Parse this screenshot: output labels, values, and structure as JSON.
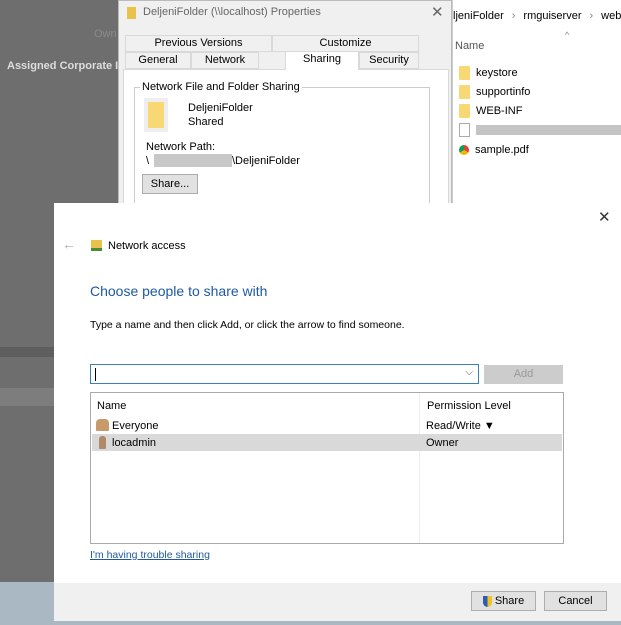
{
  "background": {
    "label_owner": "Own",
    "label_assigned": "Assigned Corporate I"
  },
  "properties": {
    "title": "DeljeniFolder (\\\\localhost) Properties",
    "tabs_row1": [
      "Previous Versions",
      "Customize"
    ],
    "tabs_row2": [
      "General",
      "Network",
      "Sharing",
      "Security"
    ],
    "group_title": "Network File and Folder Sharing",
    "folder_name": "DeljeniFolder",
    "folder_status": "Shared",
    "network_path_label": "Network Path:",
    "network_path_prefix": "\\",
    "network_path_suffix": "\\DeljeniFolder",
    "share_button": "Share..."
  },
  "explorer": {
    "breadcrumb": [
      "ljeniFolder",
      "rmguiserver",
      "web"
    ],
    "column_name": "Name",
    "items": [
      {
        "name": "keystore",
        "type": "folder"
      },
      {
        "name": "supportinfo",
        "type": "folder"
      },
      {
        "name": "WEB-INF",
        "type": "folder"
      },
      {
        "name": "",
        "type": "file-blurred"
      },
      {
        "name": "sample.pdf",
        "type": "pdf"
      }
    ]
  },
  "network_access": {
    "title": "Network access",
    "heading": "Choose people to share with",
    "instruction": "Type a name and then click Add, or click the arrow to find someone.",
    "input_value": "",
    "add_button": "Add",
    "columns": [
      "Name",
      "Permission Level"
    ],
    "rows": [
      {
        "name": "Everyone",
        "permission": "Read/Write ▼"
      },
      {
        "name": "locadmin",
        "permission": "Owner"
      }
    ],
    "help_link": "I'm having trouble sharing",
    "share_button": "Share",
    "cancel_button": "Cancel",
    "accent_color": "#1e5aa0"
  }
}
